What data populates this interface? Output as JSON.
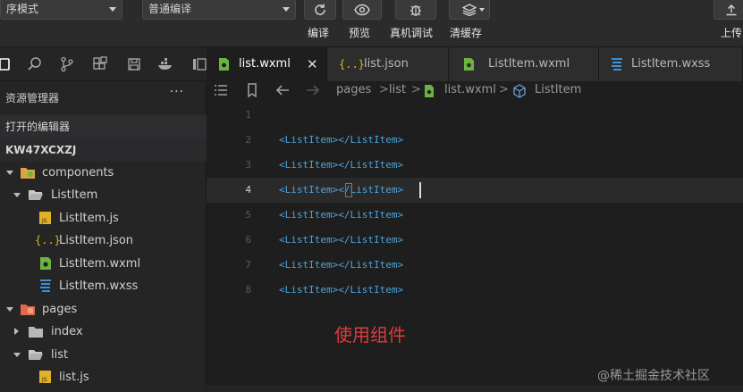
{
  "toolbar": {
    "mode_select": "序模式",
    "compile_select": "普通编译",
    "buttons": [
      {
        "label": "编译",
        "icon": "refresh-icon"
      },
      {
        "label": "预览",
        "icon": "eye-icon"
      },
      {
        "label": "真机调试",
        "icon": "bug-icon"
      },
      {
        "label": "清缓存",
        "icon": "layers-icon"
      }
    ],
    "upload_label": "上传"
  },
  "sidebar": {
    "title": "资源管理器",
    "more": "···",
    "open_editors": "打开的编辑器",
    "project": "KW47XCXZJ",
    "tree": [
      {
        "label": "components",
        "icon": "folder-components-icon"
      },
      {
        "label": "ListItem",
        "icon": "folder-open-icon"
      },
      {
        "label": "ListItem.js",
        "icon": "js-file-icon"
      },
      {
        "label": "ListItem.json",
        "icon": "json-file-icon"
      },
      {
        "label": "ListItem.wxml",
        "icon": "wxml-file-icon"
      },
      {
        "label": "ListItem.wxss",
        "icon": "wxss-file-icon"
      },
      {
        "label": "pages",
        "icon": "folder-pages-icon"
      },
      {
        "label": "index",
        "icon": "folder-icon"
      },
      {
        "label": "list",
        "icon": "folder-open-icon"
      },
      {
        "label": "list.js",
        "icon": "js-file-icon"
      }
    ]
  },
  "tabs": [
    {
      "label": "list.wxml",
      "close": "✕"
    },
    {
      "label": "list.json"
    },
    {
      "label": "ListItem.wxml"
    },
    {
      "label": "ListItem.wxss"
    }
  ],
  "breadcrumb": {
    "items": [
      "pages",
      "list",
      "list.wxml",
      "ListItem"
    ],
    "sep": ">"
  },
  "editor": {
    "lines": [
      {
        "num": "1",
        "text": ""
      },
      {
        "num": "2",
        "text": "<ListItem></ListItem>"
      },
      {
        "num": "3",
        "text": "<ListItem></ListItem>"
      },
      {
        "num": "4",
        "text": "<ListItem></ListItem>"
      },
      {
        "num": "5",
        "text": "<ListItem></ListItem>"
      },
      {
        "num": "6",
        "text": "<ListItem></ListItem>"
      },
      {
        "num": "7",
        "text": "<ListItem></ListItem>"
      },
      {
        "num": "8",
        "text": "<ListItem></ListItem>"
      }
    ],
    "annotation": "使用组件"
  },
  "watermark": "@稀土掘金技术社区",
  "colors": {
    "code": "#4fa3d9",
    "annotation": "#e03a3a",
    "folder": "#e0a33a",
    "js": "#e0b02a",
    "wxml": "#6db33f",
    "wxss": "#3d8fd6"
  }
}
